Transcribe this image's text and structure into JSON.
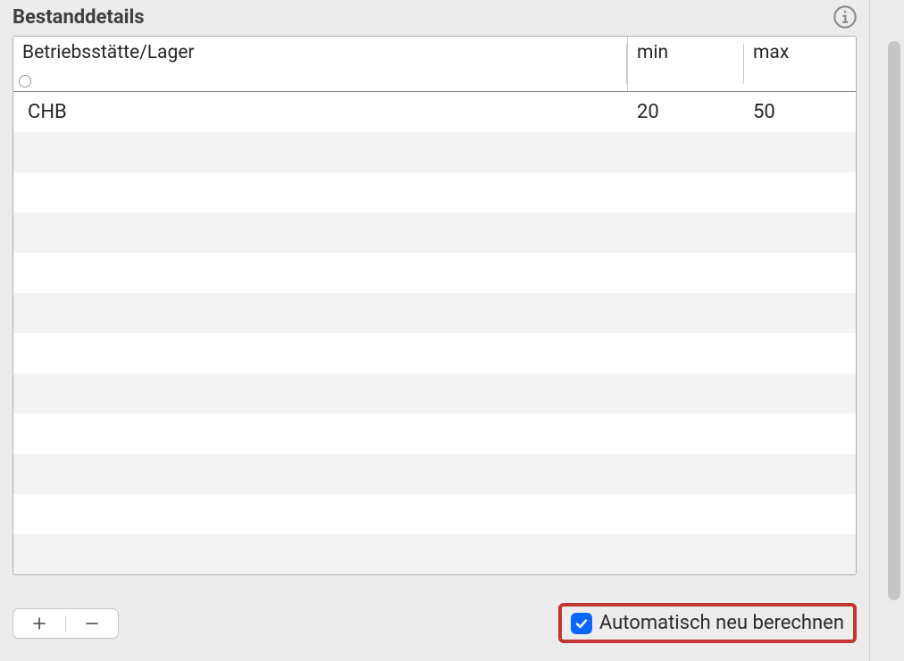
{
  "panel": {
    "title": "Bestanddetails"
  },
  "columns": {
    "location": "Betriebsstätte/Lager",
    "min": "min",
    "max": "max"
  },
  "rows": [
    {
      "location": "CHB",
      "min": "20",
      "max": "50"
    }
  ],
  "footer": {
    "auto_recalc_label": "Automatisch neu berechnen",
    "auto_recalc_checked": true
  }
}
